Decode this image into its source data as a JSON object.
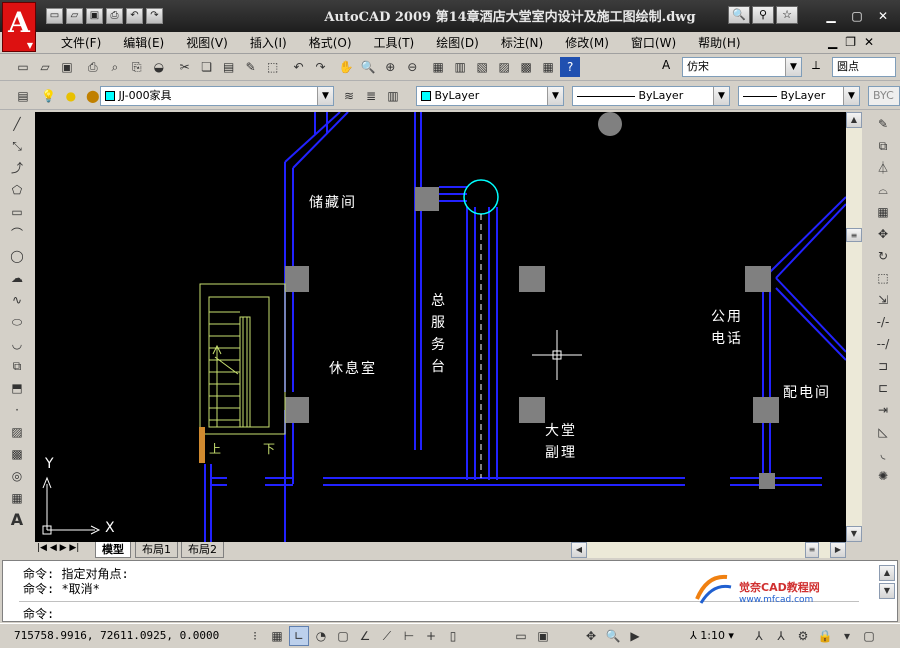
{
  "app": {
    "logo_letter": "A",
    "title": "AutoCAD 2009  第14章酒店大堂室内设计及施工图绘制.dwg"
  },
  "menu": [
    "文件(F)",
    "编辑(E)",
    "视图(V)",
    "插入(I)",
    "格式(O)",
    "工具(T)",
    "绘图(D)",
    "标注(N)",
    "修改(M)",
    "窗口(W)",
    "帮助(H)"
  ],
  "toolbar": {
    "text_style_font": "仿宋",
    "dim_style": "圆点",
    "layer_name": "JJ-000家具",
    "color": "ByLayer",
    "linetype": "ByLayer",
    "lineweight": "ByLayer",
    "plotstyle": "BYC"
  },
  "drawing": {
    "rooms": [
      "储藏间",
      "总",
      "服",
      "务",
      "台",
      "休息室",
      "公用",
      "电话",
      "配电间",
      "大堂",
      "副理"
    ],
    "stair_up": "上",
    "stair_down": "下",
    "axis_y": "Y",
    "axis_x": "X"
  },
  "tabs": [
    "模型",
    "布局1",
    "布局2"
  ],
  "command": {
    "history": [
      "命令: 指定对角点:",
      "命令: *取消*"
    ],
    "prompt": "命令:"
  },
  "watermark": {
    "brand": "觉奈CAD教程网",
    "url": "www.mfcad.com"
  },
  "status": {
    "coords": "715758.9916,  72611.0925,  0.0000",
    "annotation_scale": "1:10"
  },
  "colors": {
    "wall": "#2222ff",
    "column": "#808080",
    "stair": "#c8e070",
    "cursor": "#ffffff",
    "canvas": "#000000"
  }
}
